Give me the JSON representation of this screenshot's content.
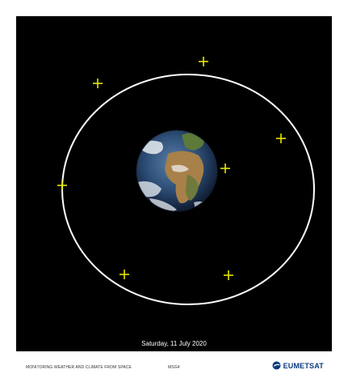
{
  "date_caption": "Saturday, 11 July 2020",
  "footer": {
    "tagline": "MONITORING WEATHER AND CLIMATE FROM SPACE",
    "satellite_label": "MSG4",
    "logo_text": "EUMETSAT"
  },
  "colors": {
    "background": "#000000",
    "orbit": "#ffffff",
    "satellite_markers": "#e6e600",
    "logo": "#0b3a7e"
  },
  "icons": {
    "earth": "earth-globe-icon",
    "satellite": "plus-marker-icon",
    "logo": "eumetsat-logo-icon"
  }
}
